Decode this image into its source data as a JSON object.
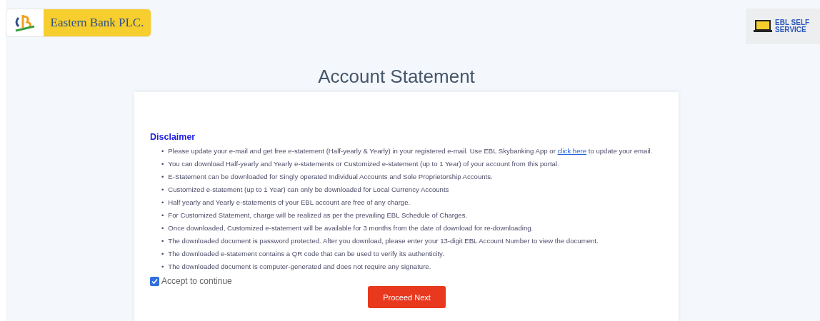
{
  "header": {
    "bank_name": "Eastern Bank PLC.",
    "self_service": "EBL SELF SERVICE"
  },
  "title": "Account Statement",
  "disclaimer": {
    "heading": "Disclaimer",
    "bullet": "•",
    "items": [
      {
        "text": "Please update your e-mail and get free e-statement (Half-yearly & Yearly) in your registered e-mail. Use EBL Skybanking App or ",
        "link": "click here",
        "after": " to update your email."
      },
      {
        "text": "You can download Half-yearly and Yearly e-statements or Customized e-statement (up to 1 Year) of your account from this portal."
      },
      {
        "text": "E-Statement can be downloaded for Singly operated Individual Accounts and Sole Proprietorship Accounts."
      },
      {
        "text": "Customized e-statement (up to 1 Year) can only be downloaded for Local Currency Accounts"
      },
      {
        "text": "Half yearly and Yearly e-statements of your EBL account are free of any charge."
      },
      {
        "text": "For Customized Statement, charge will be realized as per the prevailing EBL Schedule of Charges."
      },
      {
        "text": "Once downloaded, Customized e-statement will be available for 3 months from the date of download for re-downloading."
      },
      {
        "text": "The downloaded document is password protected. After you download, please enter your 13-digit EBL Account Number to view the document."
      },
      {
        "text": "The downloaded e-statement contains a QR code that can be used to verify its authenticity."
      },
      {
        "text": "The downloaded document is computer-generated and does not require any signature."
      }
    ]
  },
  "accept": {
    "label": "Accept to continue",
    "checked": true
  },
  "button": "Proceed Next"
}
